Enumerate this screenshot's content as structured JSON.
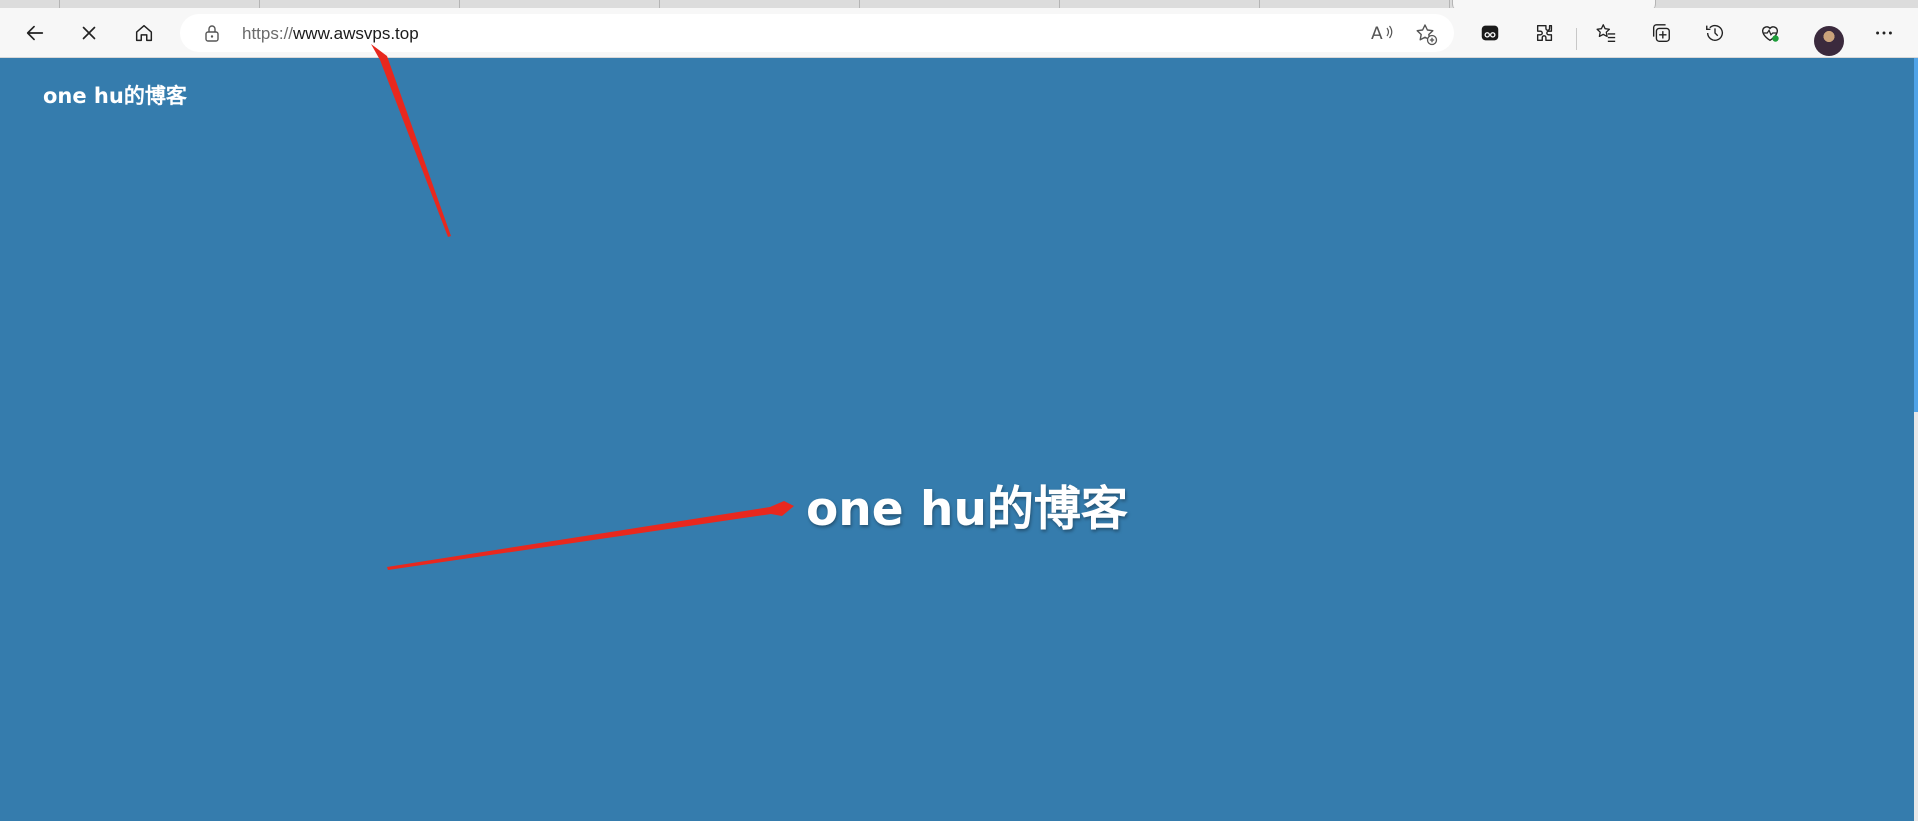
{
  "browser": {
    "address_bar": {
      "url_scheme": "https://",
      "url_host": "www.awsvps.top"
    },
    "toolbar_icons": [
      "back-arrow-icon",
      "close-icon",
      "home-icon",
      "lock-icon",
      "read-aloud-icon",
      "add-favorite-icon",
      "tab-actions-icon",
      "extensions-icon",
      "favorites-icon",
      "collections-icon",
      "history-icon",
      "browser-essentials-icon",
      "profile-avatar",
      "more-icon"
    ]
  },
  "page": {
    "site_title": "one hu的博客",
    "hero_title": "one hu的博客",
    "background_color": "#357cad",
    "text_color": "#ffffff"
  },
  "annotation": {
    "arrow_color": "#e8281e"
  }
}
